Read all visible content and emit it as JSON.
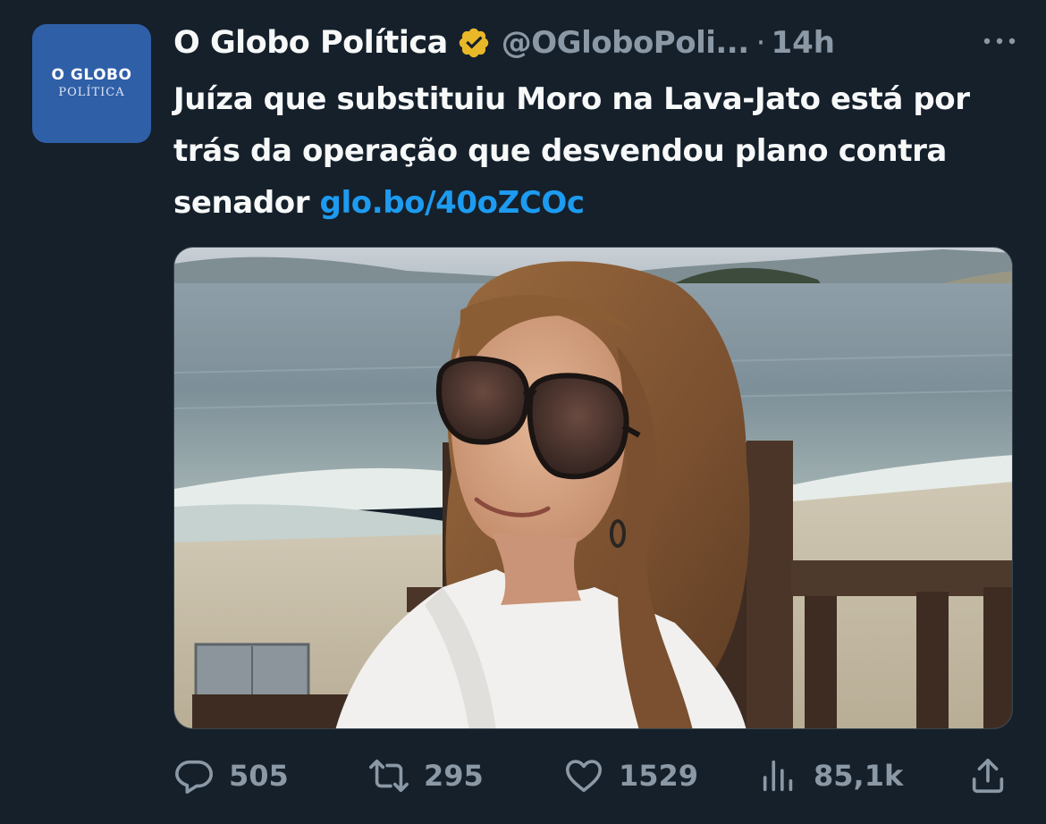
{
  "account": {
    "avatar_brand": "O GLOBO",
    "avatar_sub": "POLÍTICA",
    "display_name": "O Globo Política",
    "handle": "@OGloboPoli...",
    "separator": "·",
    "timestamp": "14h",
    "verified_icon": "verified-badge-gold"
  },
  "tweet": {
    "text": "Juíza que substituiu Moro na Lava-Jato está por trás da operação que desvendou plano contra senador ",
    "link": "glo.bo/40oZCOc"
  },
  "actions": {
    "replies": "505",
    "retweets": "295",
    "likes": "1529",
    "views": "85,1k"
  },
  "colors": {
    "background": "#15202b",
    "text": "#f7f9f9",
    "muted": "#8b98a5",
    "link": "#1d9bf0",
    "verified": "#e8b829",
    "avatar": "#2f5fa7"
  }
}
